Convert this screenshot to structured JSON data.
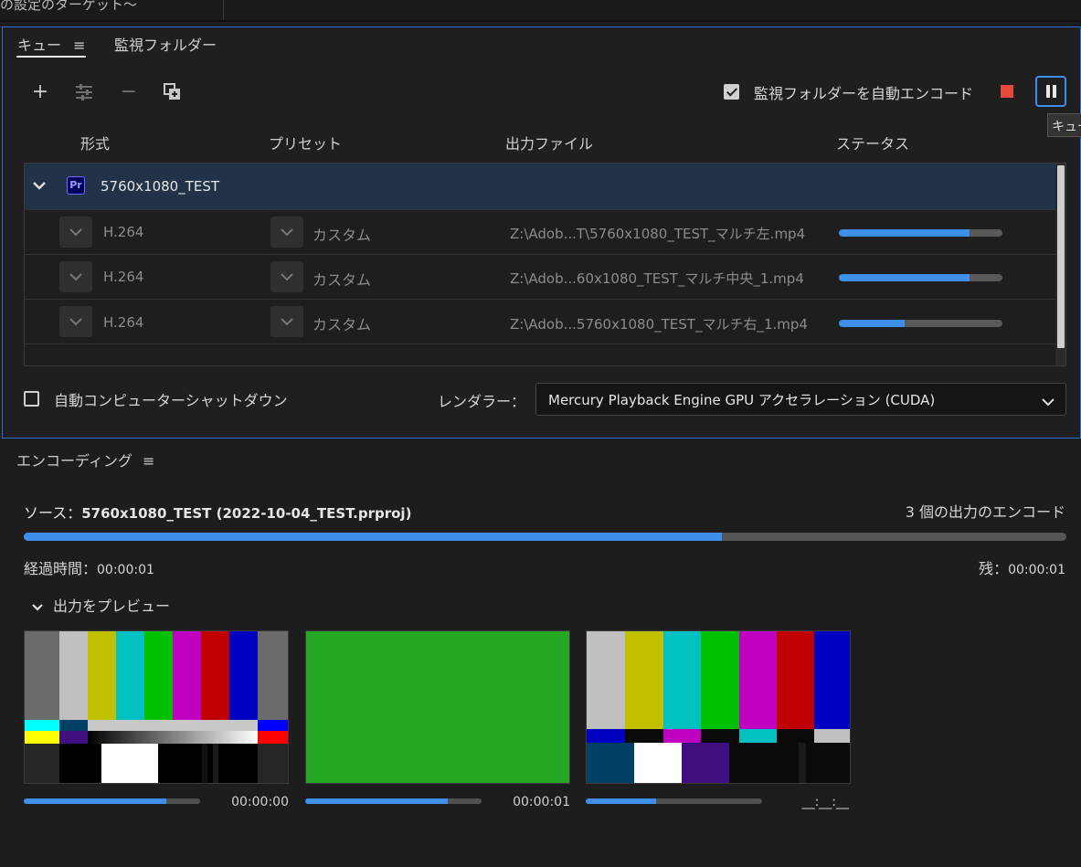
{
  "top": {
    "title_fragment": "の設定のターゲット〜"
  },
  "queue": {
    "tabs": [
      {
        "label": "キュー"
      },
      {
        "label": "監視フォルダー"
      }
    ],
    "auto_encode_label": "監視フォルダーを自動エンコード",
    "auto_encode_checked": true,
    "tooltip": "キュー",
    "columns": {
      "format": "形式",
      "preset": "プリセット",
      "output": "出力ファイル",
      "status": "ステータス"
    },
    "group": {
      "name": "5760x1080_TEST",
      "app_icon": "Pr"
    },
    "rows": [
      {
        "format": "H.264",
        "preset": "カスタム",
        "output": "Z:\\Adob...T\\5760x1080_TEST_マルチ左.mp4",
        "progress": 0.8
      },
      {
        "format": "H.264",
        "preset": "カスタム",
        "output": "Z:\\Adob...60x1080_TEST_マルチ中央_1.mp4",
        "progress": 0.8
      },
      {
        "format": "H.264",
        "preset": "カスタム",
        "output": "Z:\\Adob...5760x1080_TEST_マルチ右_1.mp4",
        "progress": 0.4
      }
    ],
    "shutdown_label": "自動コンピューターシャットダウン",
    "renderer_label": "レンダラー：",
    "renderer_value": "Mercury Playback Engine GPU アクセラレーション (CUDA)"
  },
  "encoding": {
    "title": "エンコーディング",
    "source_prefix": "ソース：",
    "source_value": "5760x1080_TEST (2022-10-04_TEST.prproj)",
    "outputs_count": "3 個の出力のエンコード",
    "overall_progress": 0.67,
    "elapsed_label": "経過時間：",
    "elapsed_value": "00:00:01",
    "remaining_label": "残：",
    "remaining_value": "00:00:01",
    "preview_toggle": "出力をプレビュー",
    "previews": [
      {
        "time": "00:00:00",
        "progress": 0.81
      },
      {
        "time": "00:00:01",
        "progress": 0.81
      },
      {
        "time": "__:__:__",
        "progress": 0.4
      }
    ]
  },
  "colors": {
    "accent": "#3d8fe8",
    "stop": "#e8493a",
    "panel_border": "#2d6fd6",
    "group_row": "#223349"
  }
}
